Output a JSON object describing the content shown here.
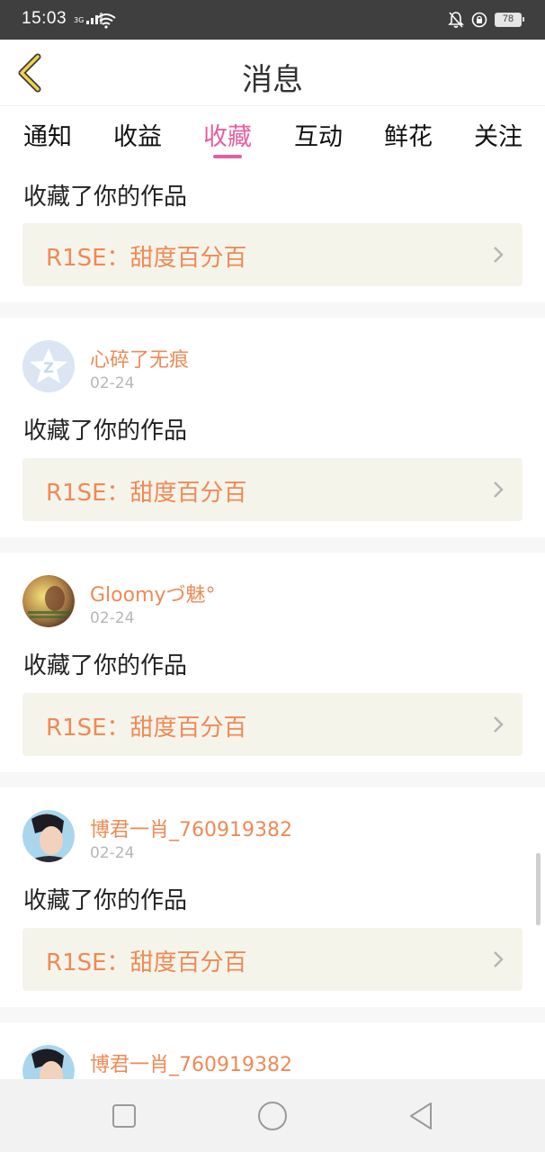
{
  "status_bar": {
    "time": "15:03",
    "network_type": "3G",
    "battery": "78"
  },
  "header": {
    "title": "消息"
  },
  "tabs": [
    {
      "label": "通知"
    },
    {
      "label": "收益"
    },
    {
      "label": "收藏",
      "active": true
    },
    {
      "label": "互动"
    },
    {
      "label": "鲜花"
    },
    {
      "label": "关注"
    }
  ],
  "feed": {
    "partial_top": {
      "action": "收藏了你的作品",
      "work_title": "R1SE：甜度百分百"
    },
    "items": [
      {
        "username": "心碎了无痕",
        "date": "02-24",
        "action": "收藏了你的作品",
        "work_title": "R1SE：甜度百分百",
        "avatar": "default-star-avatar"
      },
      {
        "username": "Gloomyづ魅°",
        "date": "02-24",
        "action": "收藏了你的作品",
        "work_title": "R1SE：甜度百分百",
        "avatar": "photo-avatar"
      },
      {
        "username": "博君一肖_760919382",
        "date": "02-24",
        "action": "收藏了你的作品",
        "work_title": "R1SE：甜度百分百",
        "avatar": "photo-avatar"
      },
      {
        "username": "博君一肖_760919382",
        "avatar": "photo-avatar"
      }
    ]
  },
  "icons": {
    "back": "back-arrow-icon",
    "chevron": "chevron-right-icon",
    "nav": [
      "recents-square-icon",
      "home-circle-icon",
      "back-triangle-icon"
    ]
  },
  "colors": {
    "accent": "#e65fa0",
    "username": "#ee8a55",
    "work_box_bg": "#f5f4eb",
    "status_bar": "#3f3f3f"
  }
}
